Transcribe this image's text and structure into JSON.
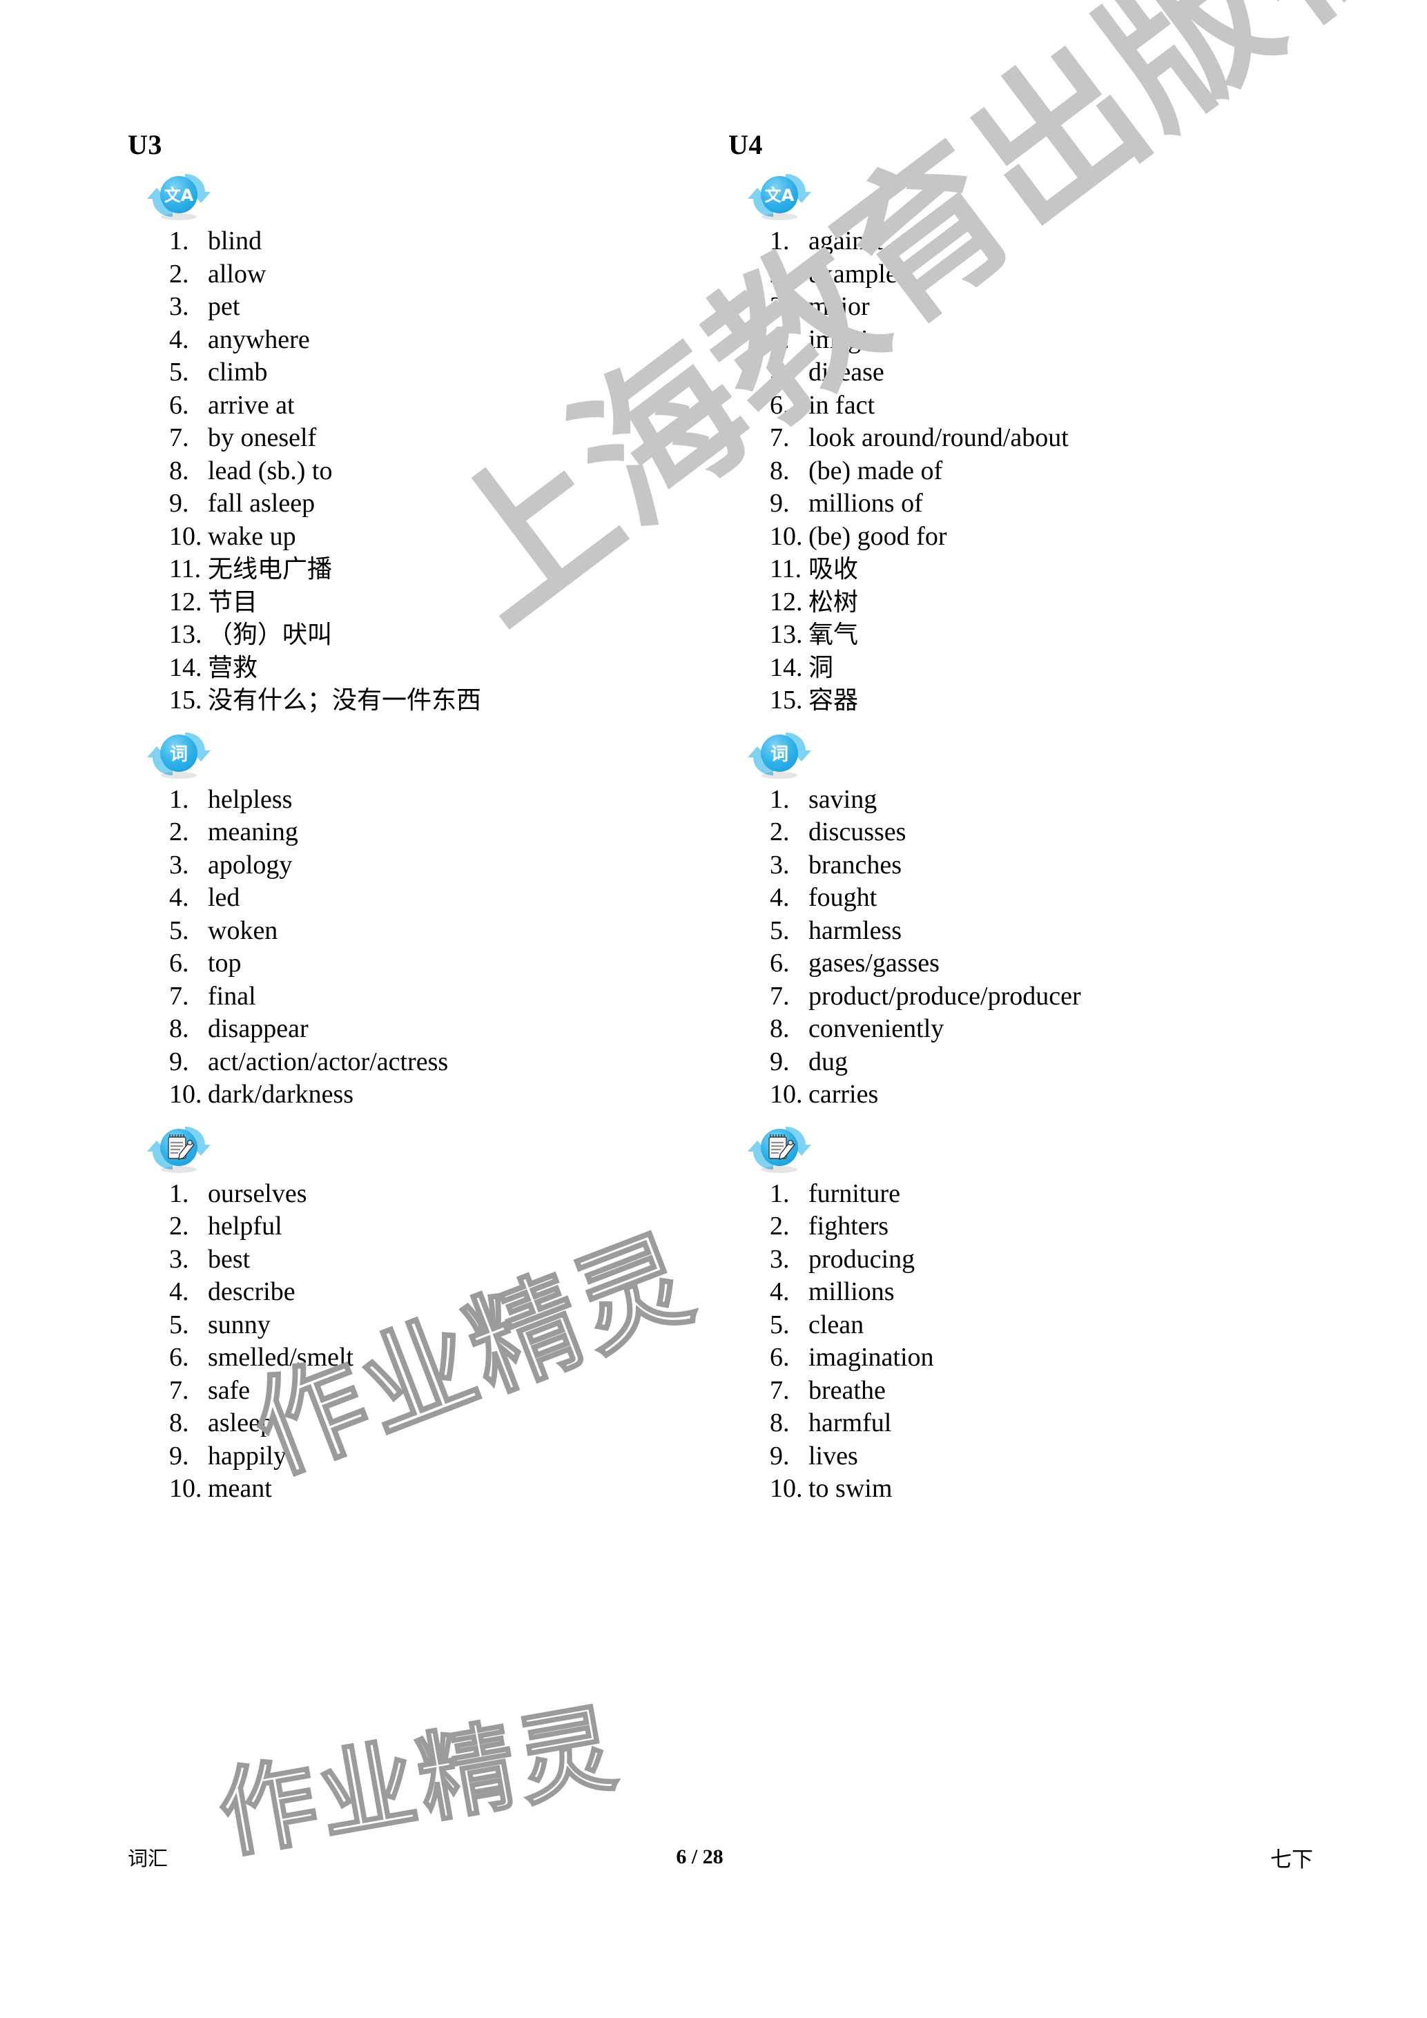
{
  "page": {
    "background_color": "#ffffff",
    "accent_color": "#2fb0e8",
    "watermark_color": "#c6c6c6"
  },
  "watermarks": {
    "publisher": "上海教育出版社",
    "brand_upper": "作业精灵",
    "brand_lower": "作业精灵"
  },
  "columns": [
    {
      "unit_title": "U3",
      "sections": [
        {
          "icon": "translate-icon",
          "icon_glyph": "文A",
          "items": [
            {
              "num": "1.",
              "text": "blind",
              "lang": "en"
            },
            {
              "num": "2.",
              "text": "allow",
              "lang": "en"
            },
            {
              "num": "3.",
              "text": "pet",
              "lang": "en"
            },
            {
              "num": "4.",
              "text": "anywhere",
              "lang": "en"
            },
            {
              "num": "5.",
              "text": "climb",
              "lang": "en"
            },
            {
              "num": "6.",
              "text": "arrive at",
              "lang": "en"
            },
            {
              "num": "7.",
              "text": "by oneself",
              "lang": "en"
            },
            {
              "num": "8.",
              "text": "lead (sb.) to",
              "lang": "en"
            },
            {
              "num": "9.",
              "text": "fall asleep",
              "lang": "en"
            },
            {
              "num": "10.",
              "text": "wake up",
              "lang": "en"
            },
            {
              "num": "11.",
              "text": "无线电广播",
              "lang": "cn"
            },
            {
              "num": "12.",
              "text": "节目",
              "lang": "cn"
            },
            {
              "num": "13.",
              "text": "（狗）吠叫",
              "lang": "cn"
            },
            {
              "num": "14.",
              "text": "营救",
              "lang": "cn"
            },
            {
              "num": "15.",
              "text": "没有什么；没有一件东西",
              "lang": "cn"
            }
          ]
        },
        {
          "icon": "word-icon",
          "icon_glyph": "词",
          "items": [
            {
              "num": "1.",
              "text": "helpless",
              "lang": "en"
            },
            {
              "num": "2.",
              "text": "meaning",
              "lang": "en"
            },
            {
              "num": "3.",
              "text": "apology",
              "lang": "en"
            },
            {
              "num": "4.",
              "text": "led",
              "lang": "en"
            },
            {
              "num": "5.",
              "text": "woken",
              "lang": "en"
            },
            {
              "num": "6.",
              "text": "top",
              "lang": "en"
            },
            {
              "num": "7.",
              "text": "final",
              "lang": "en"
            },
            {
              "num": "8.",
              "text": "disappear",
              "lang": "en"
            },
            {
              "num": "9.",
              "text": "act/action/actor/actress",
              "lang": "en"
            },
            {
              "num": "10.",
              "text": "dark/darkness",
              "lang": "en"
            }
          ]
        },
        {
          "icon": "notepad-pencil-icon",
          "icon_glyph": "",
          "items": [
            {
              "num": "1.",
              "text": "ourselves",
              "lang": "en"
            },
            {
              "num": "2.",
              "text": "helpful",
              "lang": "en"
            },
            {
              "num": "3.",
              "text": "best",
              "lang": "en"
            },
            {
              "num": "4.",
              "text": "describe",
              "lang": "en"
            },
            {
              "num": "5.",
              "text": "sunny",
              "lang": "en"
            },
            {
              "num": "6.",
              "text": "smelled/smelt",
              "lang": "en"
            },
            {
              "num": "7.",
              "text": "safe",
              "lang": "en"
            },
            {
              "num": "8.",
              "text": "asleep",
              "lang": "en"
            },
            {
              "num": "9.",
              "text": "happily",
              "lang": "en"
            },
            {
              "num": "10.",
              "text": "meant",
              "lang": "en"
            }
          ]
        }
      ]
    },
    {
      "unit_title": "U4",
      "sections": [
        {
          "icon": "translate-icon",
          "icon_glyph": "文A",
          "items": [
            {
              "num": "1.",
              "text": "against",
              "lang": "en"
            },
            {
              "num": "2.",
              "text": "example",
              "lang": "en"
            },
            {
              "num": "3.",
              "text": "major",
              "lang": "en"
            },
            {
              "num": "4.",
              "text": "imagine",
              "lang": "en"
            },
            {
              "num": "5.",
              "text": "disease",
              "lang": "en"
            },
            {
              "num": "6.",
              "text": "in fact",
              "lang": "en"
            },
            {
              "num": "7.",
              "text": "look around/round/about",
              "lang": "en"
            },
            {
              "num": "8.",
              "text": "(be) made of",
              "lang": "en"
            },
            {
              "num": "9.",
              "text": "millions of",
              "lang": "en"
            },
            {
              "num": "10.",
              "text": "(be) good for",
              "lang": "en"
            },
            {
              "num": "11.",
              "text": "吸收",
              "lang": "cn"
            },
            {
              "num": "12.",
              "text": "松树",
              "lang": "cn"
            },
            {
              "num": "13.",
              "text": "氧气",
              "lang": "cn"
            },
            {
              "num": "14.",
              "text": "洞",
              "lang": "cn"
            },
            {
              "num": "15.",
              "text": "容器",
              "lang": "cn"
            }
          ]
        },
        {
          "icon": "word-icon",
          "icon_glyph": "词",
          "items": [
            {
              "num": "1.",
              "text": "saving",
              "lang": "en"
            },
            {
              "num": "2.",
              "text": "discusses",
              "lang": "en"
            },
            {
              "num": "3.",
              "text": "branches",
              "lang": "en"
            },
            {
              "num": "4.",
              "text": "fought",
              "lang": "en"
            },
            {
              "num": "5.",
              "text": "harmless",
              "lang": "en"
            },
            {
              "num": "6.",
              "text": "gases/gasses",
              "lang": "en"
            },
            {
              "num": "7.",
              "text": "product/produce/producer",
              "lang": "en"
            },
            {
              "num": "8.",
              "text": "conveniently",
              "lang": "en"
            },
            {
              "num": "9.",
              "text": "dug",
              "lang": "en"
            },
            {
              "num": "10.",
              "text": "carries",
              "lang": "en"
            }
          ]
        },
        {
          "icon": "notepad-pencil-icon",
          "icon_glyph": "",
          "items": [
            {
              "num": "1.",
              "text": "furniture",
              "lang": "en"
            },
            {
              "num": "2.",
              "text": "fighters",
              "lang": "en"
            },
            {
              "num": "3.",
              "text": "producing",
              "lang": "en"
            },
            {
              "num": "4.",
              "text": "millions",
              "lang": "en"
            },
            {
              "num": "5.",
              "text": "clean",
              "lang": "en"
            },
            {
              "num": "6.",
              "text": "imagination",
              "lang": "en"
            },
            {
              "num": "7.",
              "text": "breathe",
              "lang": "en"
            },
            {
              "num": "8.",
              "text": "harmful",
              "lang": "en"
            },
            {
              "num": "9.",
              "text": "lives",
              "lang": "en"
            },
            {
              "num": "10.",
              "text": "to swim",
              "lang": "en"
            }
          ]
        }
      ]
    }
  ],
  "footer": {
    "left": "词汇",
    "page_indicator": "6 / 28",
    "right": "七下"
  }
}
